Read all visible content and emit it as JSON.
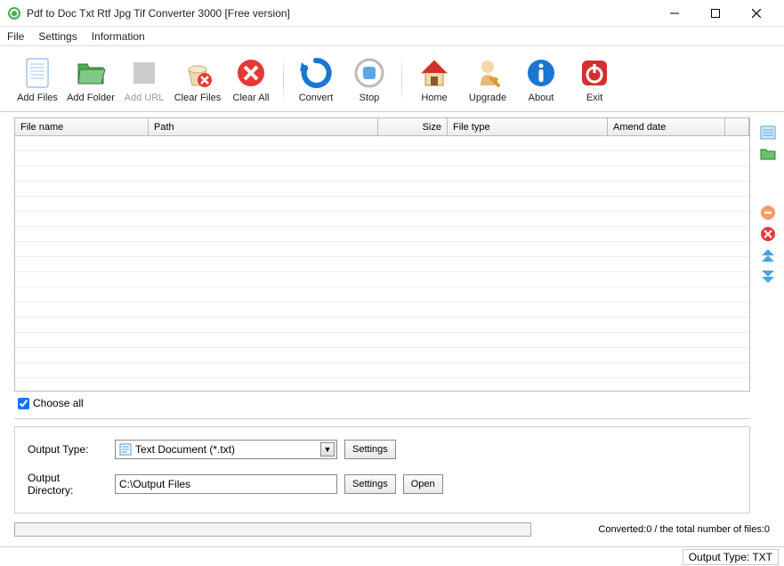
{
  "window": {
    "title": "Pdf to Doc Txt Rtf Jpg Tif Converter 3000 [Free version]"
  },
  "menu": {
    "file": "File",
    "settings": "Settings",
    "information": "Information"
  },
  "toolbar": {
    "addFiles": "Add Files",
    "addFolder": "Add Folder",
    "addURL": "Add URL",
    "clearFiles": "Clear Files",
    "clearAll": "Clear All",
    "convert": "Convert",
    "stop": "Stop",
    "home": "Home",
    "upgrade": "Upgrade",
    "about": "About",
    "exit": "Exit"
  },
  "columns": {
    "fileName": "File name",
    "path": "Path",
    "size": "Size",
    "fileType": "File type",
    "amendDate": "Amend date"
  },
  "chooseAll": "Choose all",
  "outputTypeLabel": "Output Type:",
  "outputTypeValue": "Text Document (*.txt)",
  "outputDirLabel": "Output Directory:",
  "outputDirValue": "C:\\Output Files",
  "btn": {
    "settings": "Settings",
    "open": "Open"
  },
  "progress": {
    "text": "Converted:0  /  the total number of files:0"
  },
  "status": {
    "outputType": "Output Type: TXT"
  }
}
